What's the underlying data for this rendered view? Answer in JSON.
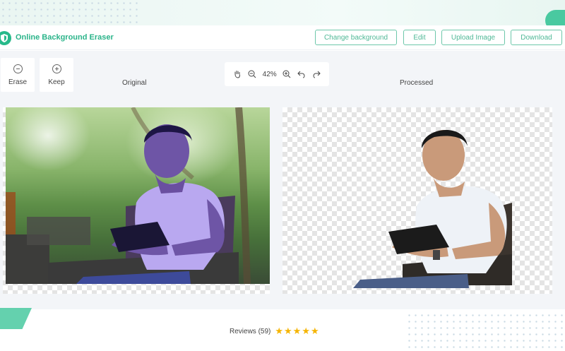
{
  "app": {
    "name": "Online Background Eraser"
  },
  "header": {
    "buttons": [
      {
        "label": "Change background"
      },
      {
        "label": "Edit"
      },
      {
        "label": "Upload Image"
      },
      {
        "label": "Download"
      }
    ]
  },
  "tools": {
    "erase_label": "Erase",
    "keep_label": "Keep"
  },
  "zoom": {
    "level": "42%",
    "icons": [
      "hand-icon",
      "zoom-out-icon",
      "zoom-in-icon",
      "undo-icon",
      "redo-icon"
    ]
  },
  "panes": {
    "original_label": "Original",
    "processed_label": "Processed"
  },
  "footer": {
    "reviews_label": "Reviews (59)",
    "rating": 5,
    "rating_max": 5
  },
  "colors": {
    "brand": "#2bb48a",
    "accent_border": "#6dc7aa",
    "star": "#f5b400",
    "workspace_bg": "#f3f5f8"
  }
}
